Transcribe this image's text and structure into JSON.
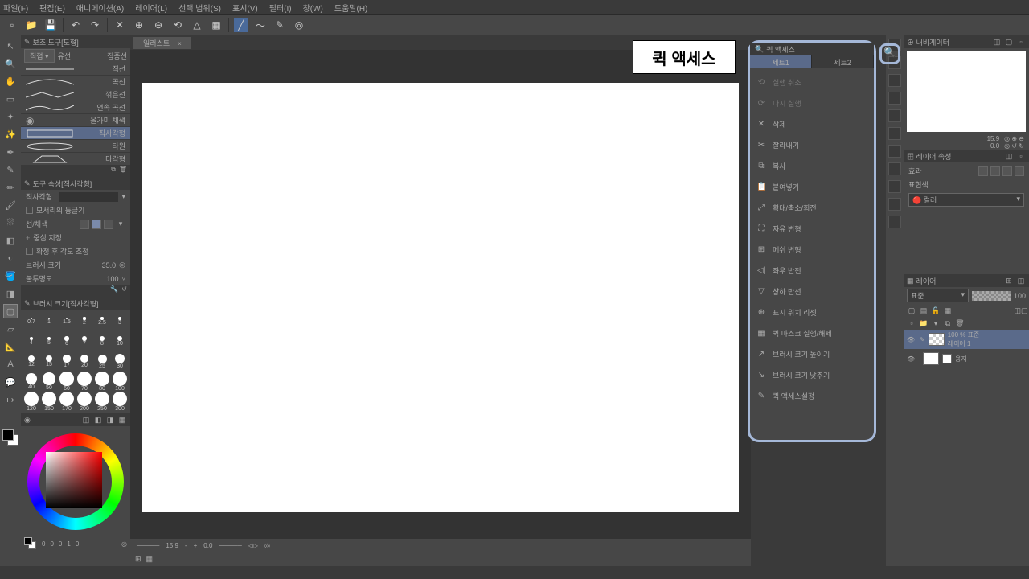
{
  "menubar": [
    "파일(F)",
    "편집(E)",
    "애니메이션(A)",
    "레이어(L)",
    "선택 범위(S)",
    "표시(V)",
    "필터(I)",
    "창(W)",
    "도움말(H)"
  ],
  "callout": "퀵 액세스",
  "tabs": {
    "illust": "일러스트",
    "close": "×"
  },
  "subtool_panel": {
    "title": "보조 도구[도형]",
    "mode1": "직접 ▾",
    "mode2": "유선",
    "mode3": "집중선"
  },
  "stroke_items": [
    "직선",
    "곡선",
    "꺾은선",
    "연속 곡선",
    "올가미 채색",
    "직사각형",
    "타원",
    "다각형"
  ],
  "toolprop": {
    "title": "도구 속성[직사각형]",
    "preset": "직사각형",
    "round": "모서리의 둥글기",
    "linefill": "선/채색",
    "center": "중심 지정",
    "aspect": "확정 후 각도 조정",
    "brushsize": "브러시 크기",
    "brushsize_val": "35.0",
    "opacity": "불투명도",
    "opacity_val": "100"
  },
  "brushsize_panel": {
    "title": "브러시 크기[직사각형]",
    "sizes": [
      0.7,
      1,
      1.5,
      2,
      2.5,
      3,
      4,
      5,
      6,
      7,
      8,
      10,
      12,
      15,
      17,
      20,
      25,
      30,
      40,
      50,
      60,
      70,
      80,
      100,
      120,
      150,
      170,
      200,
      250,
      300
    ]
  },
  "color_foot": [
    "0",
    "0",
    "0",
    "1",
    "0"
  ],
  "quick": {
    "title": "퀵 액세스",
    "tabs": [
      "세트1",
      "세트2"
    ],
    "items": [
      {
        "icon": "⟲",
        "label": "실행 취소",
        "dim": true
      },
      {
        "icon": "⟳",
        "label": "다시 실행",
        "dim": true
      },
      {
        "icon": "✕",
        "label": "삭제",
        "dim": false
      },
      {
        "icon": "✂",
        "label": "잘라내기",
        "dim": false
      },
      {
        "icon": "⧉",
        "label": "복사",
        "dim": false
      },
      {
        "icon": "📋",
        "label": "붙여넣기",
        "dim": false
      },
      {
        "icon": "⤢",
        "label": "확대/축소/회전",
        "dim": false
      },
      {
        "icon": "⛶",
        "label": "자유 변형",
        "dim": false
      },
      {
        "icon": "⊞",
        "label": "메쉬 변형",
        "dim": false
      },
      {
        "icon": "◁|",
        "label": "좌우 반전",
        "dim": false
      },
      {
        "icon": "▽",
        "label": "상하 반전",
        "dim": false
      },
      {
        "icon": "⊕",
        "label": "표시 위치 리셋",
        "dim": false
      },
      {
        "icon": "▦",
        "label": "퀵 마스크 실행/해제",
        "dim": false
      },
      {
        "icon": "↗",
        "label": "브러시 크기 높이기",
        "dim": false
      },
      {
        "icon": "↘",
        "label": "브러시 크기 낮추기",
        "dim": false
      },
      {
        "icon": "✎",
        "label": "퀵 액세스설정",
        "dim": false
      }
    ]
  },
  "nav": {
    "title": "내비게이터",
    "zoom": "15.9",
    "angle": "0.0"
  },
  "layerprop": {
    "title": "레이어 속성",
    "effect": "효과",
    "rendercolor": "표현색",
    "mode": "컬러"
  },
  "layers": {
    "title": "레이어",
    "blend": "표준",
    "opacity": "100",
    "items": [
      {
        "name": "레이어 1",
        "pct": "100 % 표준",
        "sel": true,
        "check": true
      },
      {
        "name": "용지",
        "pct": "",
        "sel": false,
        "check": false
      }
    ]
  },
  "canvas_status": {
    "zoom": "15.9",
    "angle": "0.0"
  }
}
